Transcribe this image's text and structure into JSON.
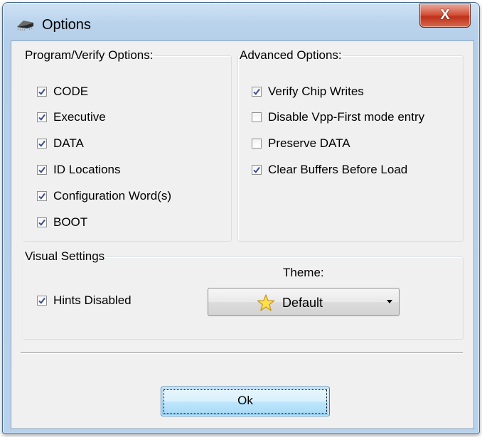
{
  "window": {
    "title": "Options",
    "close_symbol": "X",
    "title_icon": "chip-icon"
  },
  "program_verify": {
    "legend": "Program/Verify Options:",
    "items": [
      {
        "label": "CODE",
        "checked": true
      },
      {
        "label": "Executive",
        "checked": true
      },
      {
        "label": "DATA",
        "checked": true
      },
      {
        "label": "ID Locations",
        "checked": true
      },
      {
        "label": "Configuration Word(s)",
        "checked": true
      },
      {
        "label": "BOOT",
        "checked": true
      }
    ]
  },
  "advanced": {
    "legend": "Advanced Options:",
    "items": [
      {
        "label": "Verify Chip Writes",
        "checked": true
      },
      {
        "label": "Disable Vpp-First mode entry",
        "checked": false
      },
      {
        "label": "Preserve DATA",
        "checked": false
      },
      {
        "label": "Clear Buffers Before Load",
        "checked": true
      }
    ]
  },
  "visual": {
    "legend": "Visual Settings",
    "hints": {
      "label": "Hints Disabled",
      "checked": true
    },
    "theme_label": "Theme:",
    "theme_value": "Default",
    "theme_icon": "star-icon"
  },
  "footer": {
    "ok_label": "Ok"
  },
  "colors": {
    "frame_top": "#cfe2f4",
    "close_red": "#c0311a",
    "client_bg": "#f0f0f0",
    "ok_button": "#bee6fd"
  }
}
